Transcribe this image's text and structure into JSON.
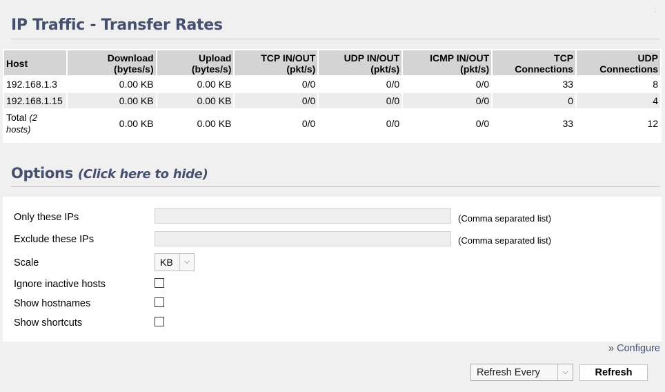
{
  "page": {
    "title": "IP Traffic - Transfer Rates"
  },
  "table": {
    "headers": [
      {
        "line1": "Host",
        "line2": ""
      },
      {
        "line1": "Download",
        "line2": "(bytes/s)"
      },
      {
        "line1": "Upload",
        "line2": "(bytes/s)"
      },
      {
        "line1": "TCP IN/OUT",
        "line2": "(pkt/s)"
      },
      {
        "line1": "UDP IN/OUT",
        "line2": "(pkt/s)"
      },
      {
        "line1": "ICMP IN/OUT",
        "line2": "(pkt/s)"
      },
      {
        "line1": "TCP",
        "line2": "Connections"
      },
      {
        "line1": "UDP",
        "line2": "Connections"
      }
    ],
    "rows": [
      [
        "192.168.1.3",
        "0.00 KB",
        "0.00 KB",
        "0/0",
        "0/0",
        "0/0",
        "33",
        "8"
      ],
      [
        "192.168.1.15",
        "0.00 KB",
        "0.00 KB",
        "0/0",
        "0/0",
        "0/0",
        "0",
        "4"
      ]
    ],
    "total": {
      "label": "Total",
      "sub": "(2 hosts)",
      "values": [
        "0.00 KB",
        "0.00 KB",
        "0/0",
        "0/0",
        "0/0",
        "33",
        "12"
      ]
    }
  },
  "options": {
    "title": "Options",
    "hide_link": "(Click here to hide)",
    "only_ips_label": "Only these IPs",
    "only_ips_value": "",
    "only_ips_hint": "(Comma separated list)",
    "exclude_ips_label": "Exclude these IPs",
    "exclude_ips_value": "",
    "exclude_ips_hint": "(Comma separated list)",
    "scale_label": "Scale",
    "scale_value": "KB",
    "ignore_inactive_label": "Ignore inactive hosts",
    "show_hostnames_label": "Show hostnames",
    "show_shortcuts_label": "Show shortcuts"
  },
  "footer": {
    "configure_prefix": "»",
    "configure_label": "Configure",
    "refresh_every_label": "Refresh Every",
    "refresh_button": "Refresh"
  }
}
